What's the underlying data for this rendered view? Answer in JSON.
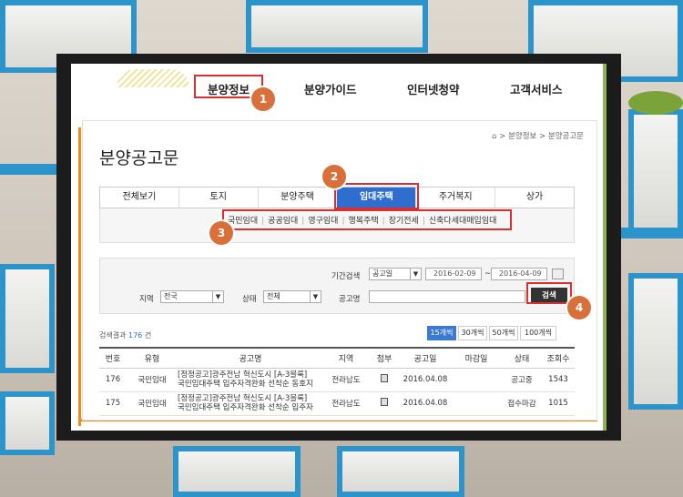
{
  "nav": {
    "items": [
      "분양정보",
      "분양가이드",
      "인터넷청약",
      "고객서비스"
    ]
  },
  "badges": [
    "1",
    "2",
    "3",
    "4"
  ],
  "breadcrumb": {
    "home_icon": "home-icon",
    "items": [
      "분양정보",
      "분양공고문"
    ],
    "separator": ">"
  },
  "page_title": "분양공고문",
  "tabs": [
    "전체보기",
    "토지",
    "분양주택",
    "임대주택",
    "주거복지",
    "상가"
  ],
  "active_tab_index": 3,
  "sub_items": [
    "국민임대",
    "공공임대",
    "영구임대",
    "행복주택",
    "장기전세",
    "신축다세대매입임대"
  ],
  "search": {
    "period_label": "기간검색",
    "period_type": "공고일",
    "date_from": "2016-02-09",
    "date_sep": "~",
    "date_to": "2016-04-09",
    "region_label": "지역",
    "region_value": "전국",
    "status_label": "상태",
    "status_value": "전체",
    "name_label": "공고명",
    "name_value": "",
    "button": "검색"
  },
  "results": {
    "prefix": "검색결과",
    "count": "176",
    "suffix": "건",
    "per_page": [
      "15개씩",
      "30개씩",
      "50개씩",
      "100개씩"
    ],
    "active_per_page": 0
  },
  "table": {
    "columns": [
      "번호",
      "유형",
      "공고명",
      "지역",
      "첨부",
      "공고일",
      "마감일",
      "상태",
      "조회수"
    ],
    "rows": [
      {
        "no": "176",
        "type": "국민임대",
        "title1": "[정정공고]광주전남 혁신도시 [A-3블록]",
        "title2": "국민임대주택 입주자격완화 선착순 동호지",
        "region": "전라남도",
        "date": "2016.04.08",
        "deadline": "",
        "status": "공고중",
        "views": "1543"
      },
      {
        "no": "175",
        "type": "국민임대",
        "title1": "[정정공고]광주전남 혁신도시 [A-3블록]",
        "title2": "국민임대주택 입주자격완화 선착순 입주자",
        "region": "전라남도",
        "date": "2016.04.08",
        "deadline": "",
        "status": "접수마감",
        "views": "1015"
      }
    ]
  },
  "colors": {
    "accent": "#2f6ecf",
    "badge": "#d9703a",
    "highlight": "#d83030"
  }
}
